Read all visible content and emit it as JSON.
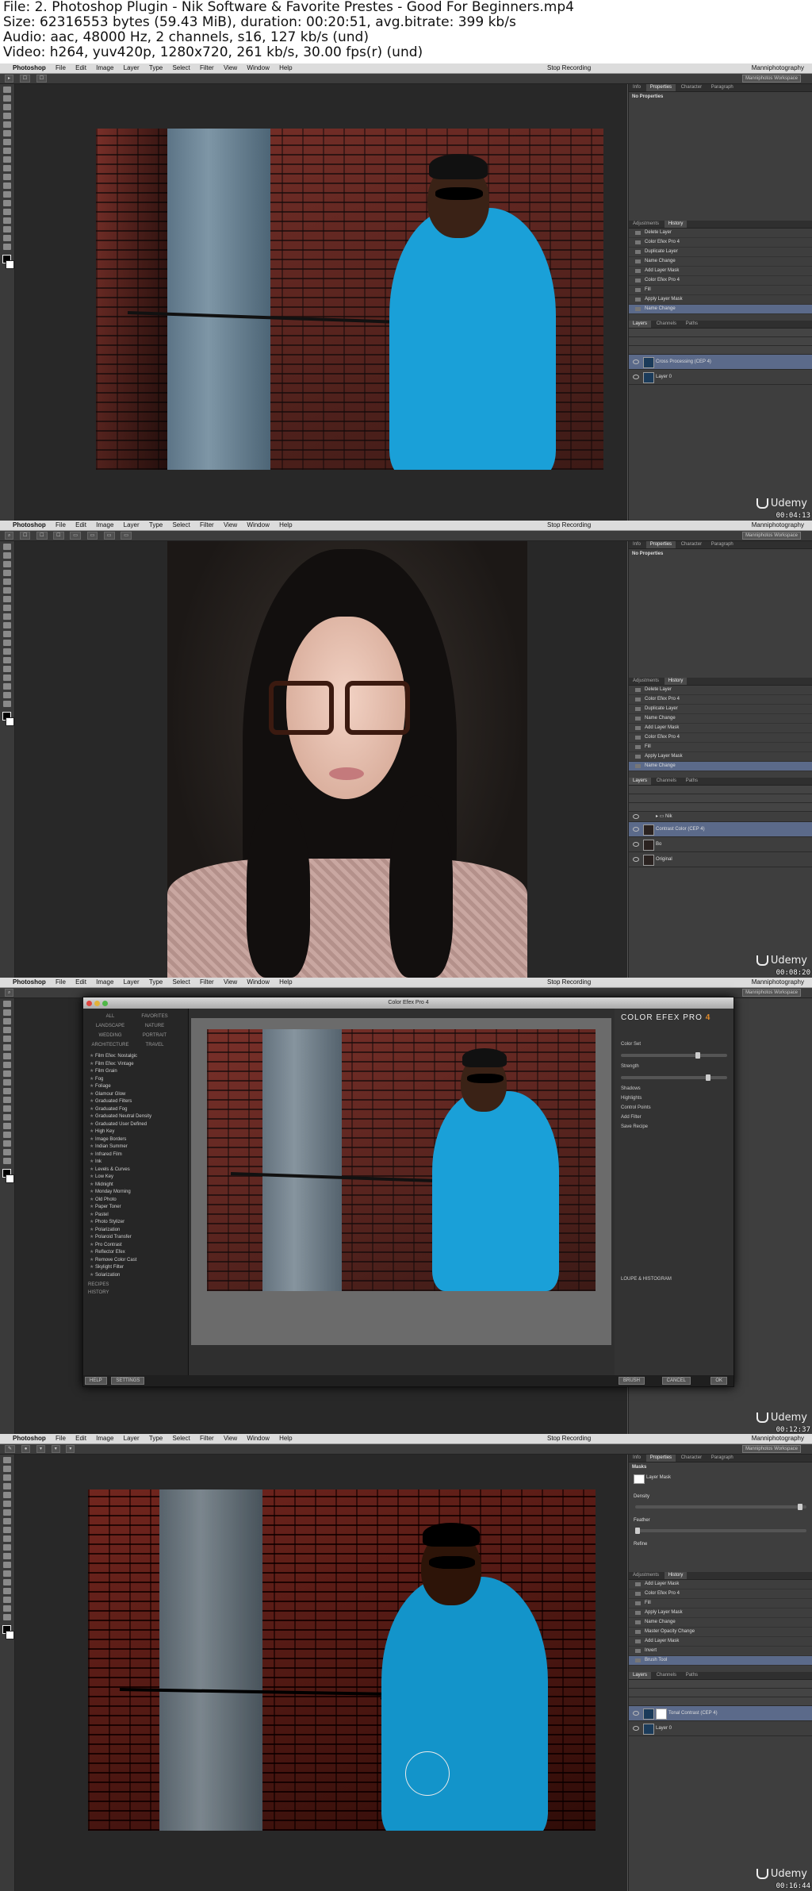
{
  "header": {
    "line1": "File: 2. Photoshop Plugin - Nik Software & Favorite Prestes - Good For Beginners.mp4",
    "line2": "Size: 62316553 bytes (59.43 MiB), duration: 00:20:51, avg.bitrate: 399 kb/s",
    "line3": "Audio: aac, 48000 Hz, 2 channels, s16, 127 kb/s (und)",
    "line4": "Video: h264, yuv420p, 1280x720, 261 kb/s, 30.00 fps(r) (und)"
  },
  "menubar": {
    "app": "Photoshop",
    "items": [
      "File",
      "Edit",
      "Image",
      "Layer",
      "Type",
      "Select",
      "Filter",
      "View",
      "Window",
      "Help"
    ],
    "recording": "Stop Recording",
    "user": "Manniphotography"
  },
  "panels": {
    "tabs": [
      "Info",
      "Properties",
      "Character",
      "Paragraph"
    ],
    "no_properties": "No Properties",
    "history_tabs": [
      "Adjustments",
      "History"
    ],
    "layers_tabs": [
      "Layers",
      "Channels",
      "Paths"
    ],
    "workspace": "Manniphotos Workspace"
  },
  "frames": [
    {
      "history": [
        "Delete Layer",
        "Color Efex Pro 4",
        "Duplicate Layer",
        "Name Change",
        "Add Layer Mask",
        "Color Efex Pro 4",
        "Fill",
        "Apply Layer Mask",
        "Name Change"
      ],
      "layers": [
        "Cross Processing (CEP 4)",
        "Layer 0"
      ],
      "timecode": "00:04:13"
    },
    {
      "history": [
        "Delete Layer",
        "Color Efex Pro 4",
        "Duplicate Layer",
        "Name Change",
        "Add Layer Mask",
        "Color Efex Pro 4",
        "Fill",
        "Apply Layer Mask",
        "Name Change"
      ],
      "layers": [
        "Nik",
        "Contrast Color (CEP 4)",
        "Bo",
        "Original"
      ],
      "timecode": "00:08:20"
    },
    {
      "dialog_title": "Color Efex Pro 4",
      "categories": [
        "ALL",
        "FAVORITES",
        "LANDSCAPE",
        "NATURE",
        "WEDDING",
        "PORTRAIT",
        "ARCHITECTURE",
        "TRAVEL"
      ],
      "filters": [
        "Film Efex: Nostalgic",
        "Film Efex: Vintage",
        "Film Grain",
        "Fog",
        "Foliage",
        "Glamour Glow",
        "Graduated Filters",
        "Graduated Fog",
        "Graduated Neutral Density",
        "Graduated User Defined",
        "High Key",
        "Image Borders",
        "Indian Summer",
        "Infrared Film",
        "Ink",
        "Levels & Curves",
        "Low Key",
        "Midnight",
        "Monday Morning",
        "Old Photo",
        "Paper Toner",
        "Pastel",
        "Photo Stylizer",
        "Polarization",
        "Polaroid Transfer",
        "Pro Contrast",
        "Reflector Efex",
        "Remove Color Cast",
        "Skylight Filter",
        "Solarization"
      ],
      "sections": [
        "RECIPES",
        "HISTORY"
      ],
      "bottom_left": [
        "HELP",
        "SETTINGS"
      ],
      "bottom_right": [
        "BRUSH",
        "CANCEL",
        "OK"
      ],
      "logo": "COLOR EFEX PRO",
      "logo_num": "4",
      "right_labels": [
        "Color Set",
        "Strength",
        "Shadows",
        "Highlights",
        "Control Points",
        "Add Filter",
        "Save Recipe",
        "LOUPE & HISTOGRAM"
      ],
      "timecode": "00:12:37"
    },
    {
      "history": [
        "Add Layer Mask",
        "Color Efex Pro 4",
        "Fill",
        "Apply Layer Mask",
        "Name Change",
        "Master Opacity Change",
        "Add Layer Mask",
        "Invert",
        "Brush Tool"
      ],
      "layers": [
        "Tonal Contrast (CEP 4)",
        "Layer 0"
      ],
      "mask_label": "Masks",
      "layer_mask": "Layer Mask",
      "props": [
        "Density",
        "Feather",
        "Refine"
      ],
      "timecode": "00:16:44"
    }
  ],
  "watermark": "Udemy"
}
